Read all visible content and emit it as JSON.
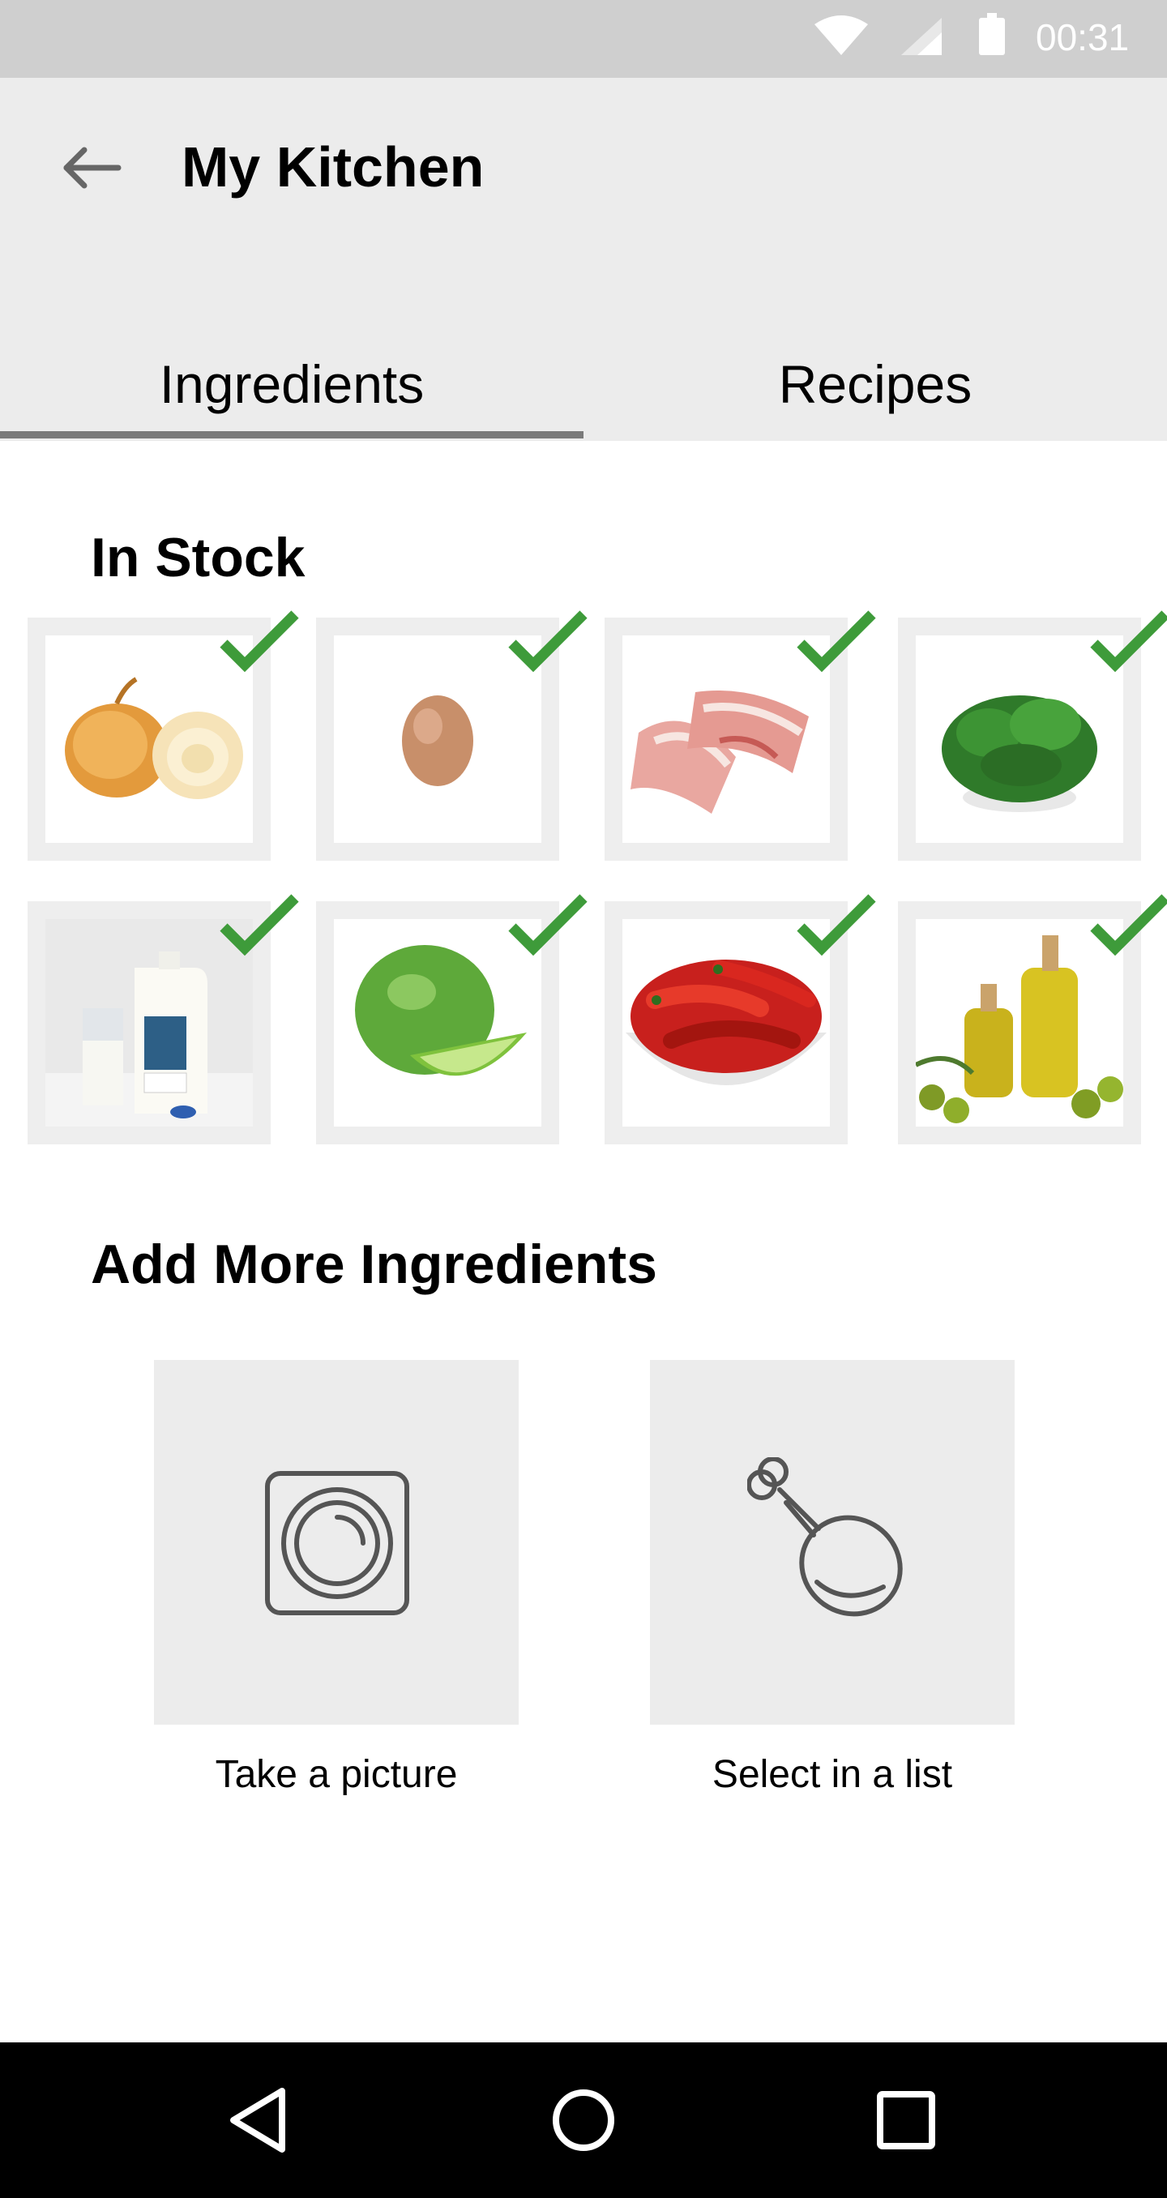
{
  "status_bar": {
    "time": "00:31"
  },
  "app_bar": {
    "title": "My Kitchen"
  },
  "tabs": [
    {
      "label": "Ingredients",
      "selected": true
    },
    {
      "label": "Recipes",
      "selected": false
    }
  ],
  "in_stock": {
    "title": "In Stock",
    "items": [
      {
        "name": "onion",
        "checked": true
      },
      {
        "name": "egg",
        "checked": true
      },
      {
        "name": "bacon",
        "checked": true
      },
      {
        "name": "basil",
        "checked": true
      },
      {
        "name": "milk",
        "checked": true
      },
      {
        "name": "lime",
        "checked": true
      },
      {
        "name": "chili peppers",
        "checked": true
      },
      {
        "name": "olive oil",
        "checked": true
      }
    ]
  },
  "add_more": {
    "title": "Add More Ingredients",
    "options": [
      {
        "label": "Take a picture",
        "icon": "camera-lens-icon"
      },
      {
        "label": "Select in a list",
        "icon": "chicken-leg-icon"
      }
    ]
  },
  "nav_bar": {
    "icons": [
      "back-triangle-icon",
      "home-circle-icon",
      "recents-square-icon"
    ]
  },
  "colors": {
    "status_bar": "#cfcfcf",
    "app_bar": "#ececec",
    "check": "#3e9b3a",
    "tab_indicator": "#7a7a7a"
  }
}
